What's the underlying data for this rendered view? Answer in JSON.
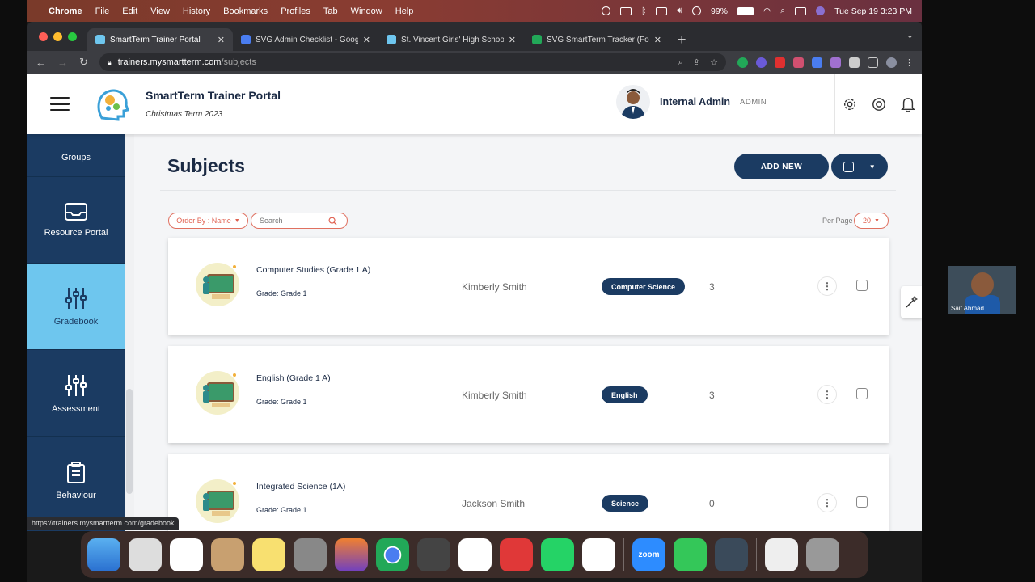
{
  "menubar": {
    "app": "Chrome",
    "items": [
      "File",
      "Edit",
      "View",
      "History",
      "Bookmarks",
      "Profiles",
      "Tab",
      "Window",
      "Help"
    ],
    "battery": "99%",
    "datetime": "Tue Sep 19  3:23 PM"
  },
  "browser": {
    "tabs": [
      {
        "label": "SmartTerm Trainer Portal",
        "color": "#6ec6ee"
      },
      {
        "label": "SVG Admin Checklist - Google",
        "color": "#4a7df0"
      },
      {
        "label": "St. Vincent Girls' High School",
        "color": "#6ec6ee"
      },
      {
        "label": "SVG SmartTerm Tracker (For A",
        "color": "#22a858"
      }
    ],
    "url_host": "trainers.mysmartterm.com",
    "url_path": "/subjects"
  },
  "header": {
    "title": "SmartTerm Trainer Portal",
    "term": "Christmas Term 2023",
    "user_name": "Internal Admin",
    "user_role": "ADMIN"
  },
  "sidebar": {
    "items": [
      {
        "label": "Groups",
        "icon": "groups-icon"
      },
      {
        "label": "Resource Portal",
        "icon": "inbox-icon"
      },
      {
        "label": "Gradebook",
        "icon": "sliders-icon"
      },
      {
        "label": "Assessment",
        "icon": "sliders-icon"
      },
      {
        "label": "Behaviour",
        "icon": "clipboard-icon"
      }
    ]
  },
  "main": {
    "title": "Subjects",
    "add_new": "ADD NEW",
    "order_by": "Order By : Name",
    "search_placeholder": "Search",
    "per_page_label": "Per Page",
    "per_page": "20"
  },
  "subjects": [
    {
      "name": "Computer Studies (Grade 1 A)",
      "grade": "Grade: Grade 1",
      "trainer": "Kimberly Smith",
      "category": "Computer Science",
      "count": "3"
    },
    {
      "name": "English (Grade 1 A)",
      "grade": "Grade: Grade 1",
      "trainer": "Kimberly Smith",
      "category": "English",
      "count": "3"
    },
    {
      "name": "Integrated Science (1A)",
      "grade": "Grade: Grade 1",
      "trainer": "Jackson Smith",
      "category": "Science",
      "count": "0"
    }
  ],
  "status_url": "https://trainers.mysmartterm.com/gradebook",
  "webcam": {
    "name": "Saif Ahmad"
  },
  "colors": {
    "navy": "#1b3b62",
    "sky": "#6ec6ee",
    "coral": "#e07060"
  }
}
